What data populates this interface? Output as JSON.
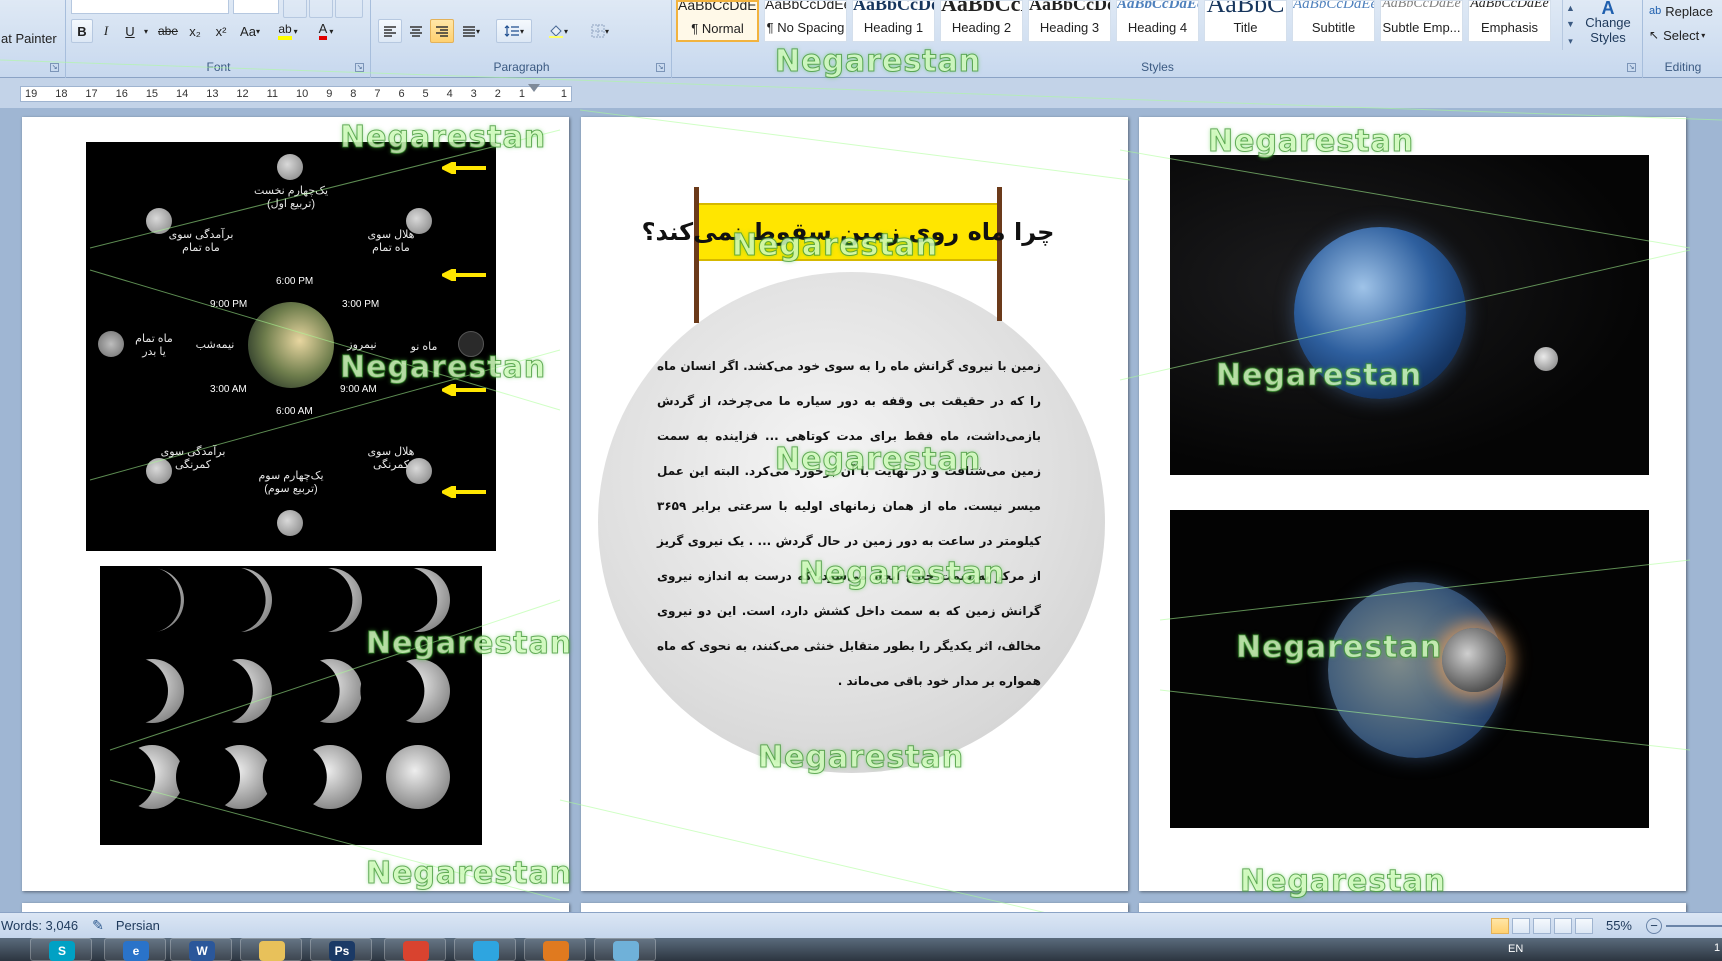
{
  "ribbon": {
    "clipboard": {
      "format_painter": "at Painter"
    },
    "font": {
      "label": "Font",
      "bold": "B",
      "italic": "I",
      "underline": "U",
      "strike": "abe",
      "subscript": "x₂",
      "superscript": "x²",
      "change_case": "Aa",
      "highlight": "ab",
      "font_color": "A"
    },
    "paragraph": {
      "label": "Paragraph"
    },
    "styles": {
      "label": "Styles",
      "tiles": [
        {
          "sample": "AaBbCcDdEe",
          "name": "¶ Normal"
        },
        {
          "sample": "AaBbCcDdEe",
          "name": "¶ No Spacing"
        },
        {
          "sample": "AaBbCcDdE",
          "name": "Heading 1"
        },
        {
          "sample": "AaBbCcDdEe",
          "name": "Heading 2"
        },
        {
          "sample": "AaBbCcDdEe",
          "name": "Heading 3"
        },
        {
          "sample": "AaBbCcDdEe",
          "name": "Heading 4"
        },
        {
          "sample": "AaBbC",
          "name": "Title"
        },
        {
          "sample": "AaBbCcDdEe",
          "name": "Subtitle"
        },
        {
          "sample": "AaBbCcDdEe",
          "name": "Subtle Emp..."
        },
        {
          "sample": "AaBbCcDdEe",
          "name": "Emphasis"
        }
      ],
      "change_styles": "Change Styles"
    },
    "editing": {
      "label": "Editing",
      "replace": "Replace",
      "select": "Select"
    }
  },
  "ruler": {
    "numbers": [
      "19",
      "18",
      "17",
      "16",
      "15",
      "14",
      "13",
      "12",
      "11",
      "10",
      "9",
      "8",
      "7",
      "6",
      "5",
      "4",
      "3",
      "2",
      "1",
      "",
      "1"
    ]
  },
  "page_left": {
    "phase_diagram": {
      "labels": {
        "first_quarter": "یک‌چهارم نخست\n(تربیع اول)",
        "waxing_gibbous": "برآمدگی سوی\nماه تمام",
        "waxing_crescent": "هلال سوی\nماه تمام",
        "full_moon": "ماه تمام\nیا بدر",
        "midnight": "نیمه‌شب",
        "noon": "نیمروز",
        "new_moon": "ماه نو",
        "waning_gibbous": "برآمدگی سوی\nکمرنگی",
        "waning_crescent": "هلال سوی\nکمرنگی",
        "third_quarter": "یک‌چهارم سوم\n(تربیع سوم)"
      },
      "times": {
        "t6pm": "6:00 PM",
        "t9pm": "9:00 PM",
        "t3pm": "3:00 PM",
        "t3am": "3:00 AM",
        "t9am": "9:00 AM",
        "t6am": "6:00 AM"
      }
    }
  },
  "page_center": {
    "banner_title": "چرا ماه روی زمین سقوط نمی‌کند؟",
    "article": "زمین با نیروی گرانش ماه را به سوی خود می‌کشد. اگر انسان ماه را که در حقیقت بی وقفه به دور سیاره ما می‌چرخد، از گردش بازمی‌داشت، ماه فقط برای مدت کوتاهی ... فزاینده به سمت زمین می‌شتافت و در نهایت با آن برخورد می‌کرد. البته این عمل میسر نیست. ماه از همان زمانهای اولیه با سرعتی برابر ۳۶۵۹ کیلومتر در ساعت به دور زمین در حال گردش ... . یک نیروی گریز از مرکز به سمت خارج ایجاد می‌شود، که درست به اندازه نیروی گرانش زمین که به سمت داخل کشش دارد، است. این دو نیروی مخالف، اثر یکدیگر را بطور متقابل خنثی می‌کنند، به نحوی که ماه همواره بر مدار خود باقی می‌ماند ."
  },
  "watermark": "Negarestan",
  "status": {
    "words": "Words: 3,046",
    "language": "Persian",
    "zoom": "55%"
  },
  "taskbar": {
    "apps": [
      "S",
      "e",
      "W",
      "",
      "Ps",
      "",
      "",
      "",
      "",
      ""
    ],
    "lang": "EN",
    "clock": "1"
  },
  "colors": {
    "banner": "#ffe600",
    "watermark": "#b8f0a0",
    "arrow": "#ffe600"
  }
}
